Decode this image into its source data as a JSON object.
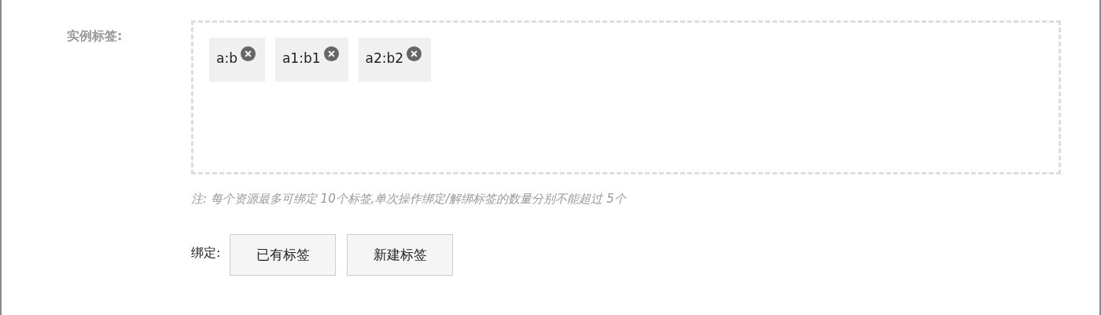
{
  "field_label": "实例标签:",
  "tags": [
    {
      "label": "a:b"
    },
    {
      "label": "a1:b1"
    },
    {
      "label": "a2:b2"
    }
  ],
  "note": "注: 每个资源最多可绑定 10个标签,单次操作绑定/解绑标签的数量分别不能超过 5个",
  "bind": {
    "label": "绑定:",
    "buttons": [
      "已有标签",
      "新建标签"
    ]
  }
}
